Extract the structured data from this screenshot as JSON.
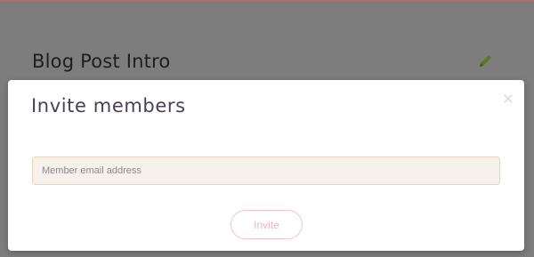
{
  "background": {
    "card_title": "Blog Post Intro",
    "edit_icon": "pencil-icon"
  },
  "modal": {
    "title": "Invite members",
    "close_icon": "close-icon",
    "email_placeholder": "Member email address",
    "email_value": "",
    "invite_label": "Invite"
  },
  "colors": {
    "overlay": "#7d7d7d",
    "accent_line": "#b46a6a",
    "title_text": "#4a3f55",
    "input_bg": "#f6f1ea",
    "input_border": "#e5d7bf",
    "button_text": "#f2b6b6",
    "button_border": "#f3c3c3"
  }
}
